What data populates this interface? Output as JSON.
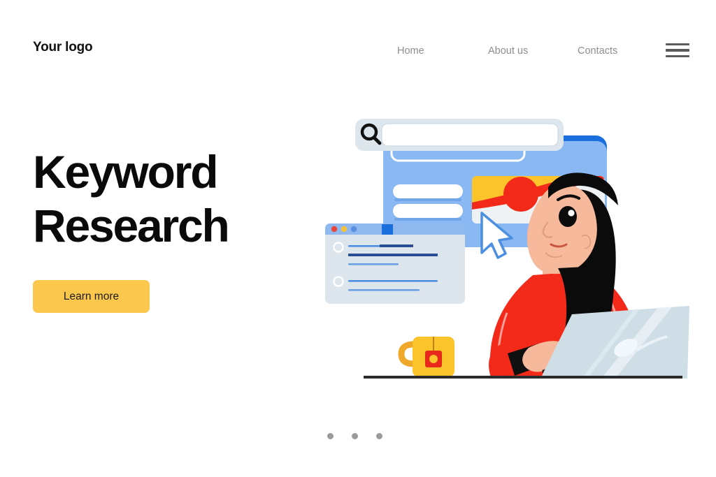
{
  "header": {
    "logo": "Your logo",
    "nav": [
      {
        "label": "Home",
        "name": "nav-link-home"
      },
      {
        "label": "About us",
        "name": "nav-link-about-us"
      },
      {
        "label": "Contacts",
        "name": "nav-link-contacts"
      }
    ],
    "menu_icon": "hamburger-icon"
  },
  "hero": {
    "title_line1": "Keyword",
    "title_line2": "Research",
    "cta_label": "Learn more"
  },
  "carousel": {
    "dots": [
      "1",
      "2",
      "3"
    ],
    "active_index": 0
  },
  "illustration": {
    "name": "keyword-research-illustration",
    "search_bar": {
      "icon": "search-icon",
      "input_value": "",
      "placeholder": ""
    },
    "browser_window": {
      "traffic_lights": [
        "red",
        "yellow",
        "blue"
      ],
      "line_groups": 2
    },
    "result_card": {
      "pill_rows": 3,
      "thumbnail": "sunrise-thumbnail",
      "cursor": "pointer-cursor-icon"
    },
    "person": {
      "hair": "long-black-hair",
      "top": "red-sweater",
      "device": "laptop"
    },
    "desk_items": [
      "mug-with-teabag",
      "laptop"
    ]
  },
  "colors": {
    "accent_yellow": "#fbc84d",
    "brand_blue": "#1976e8",
    "card_blue": "#7fb3f0",
    "panel_gray_blue": "#dde6ec",
    "nav_gray": "#8d8d8d",
    "text_black": "#0a0a0a",
    "red": "#f32a19",
    "page_background": "#ffffff"
  }
}
